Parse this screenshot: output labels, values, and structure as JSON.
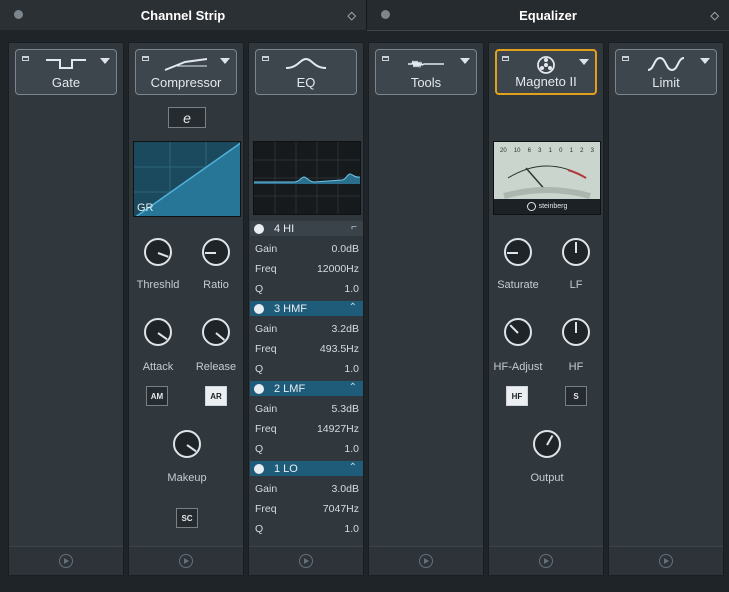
{
  "tabs": [
    {
      "label": "Channel Strip"
    },
    {
      "label": "Equalizer"
    }
  ],
  "modules": [
    {
      "label": "Gate"
    },
    {
      "label": "Compressor"
    },
    {
      "label": "EQ"
    },
    {
      "label": "Tools"
    },
    {
      "label": "Magneto II"
    },
    {
      "label": "Limit"
    }
  ],
  "compressor": {
    "mode_button": "e",
    "display_label": "GR",
    "knobs": {
      "threshold": "Threshld",
      "ratio": "Ratio",
      "attack": "Attack",
      "release": "Release",
      "makeup": "Makeup"
    },
    "am_button": "AM",
    "ar_button": "AR",
    "sc_button": "SC"
  },
  "eq": {
    "bands": [
      {
        "name": "4 HI",
        "gain": "0.0dB",
        "freq": "12000Hz",
        "q": "1.0",
        "active": false
      },
      {
        "name": "3 HMF",
        "gain": "3.2dB",
        "freq": "493.5Hz",
        "q": "1.0",
        "active": true
      },
      {
        "name": "2 LMF",
        "gain": "5.3dB",
        "freq": "14927Hz",
        "q": "1.0",
        "active": true
      },
      {
        "name": "1 LO",
        "gain": "3.0dB",
        "freq": "7047Hz",
        "q": "1.0",
        "active": true
      }
    ],
    "param_labels": {
      "gain": "Gain",
      "freq": "Freq",
      "q": "Q"
    }
  },
  "magneto": {
    "meter_brand": "steinberg",
    "meter_scale": [
      "20",
      "10",
      "6",
      "3",
      "1",
      "0",
      "1",
      "2",
      "3"
    ],
    "knobs": {
      "saturate": "Saturate",
      "lf": "LF",
      "hf_adjust": "HF-Adjust",
      "hf": "HF",
      "output": "Output"
    },
    "hf_button": "HF",
    "s_button": "S"
  },
  "colors": {
    "accent": "#e2a11b",
    "eq_band": "#1f5c7a",
    "display": "#1b4a5e"
  }
}
